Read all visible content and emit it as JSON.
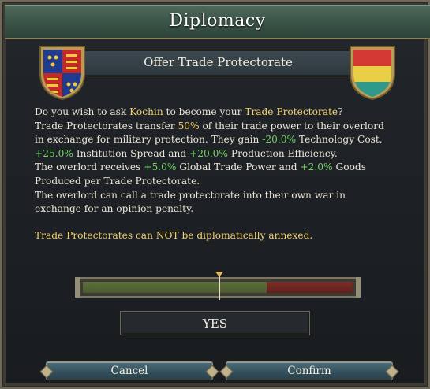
{
  "window": {
    "title": "Diplomacy"
  },
  "action": {
    "title": "Offer Trade Protectorate"
  },
  "body": {
    "q_prefix": "Do you wish to ask ",
    "q_country": "Kochin",
    "q_mid": " to become your ",
    "q_subject": "Trade Protectorate",
    "q_end": "?",
    "l2_a": "Trade Protectorates transfer ",
    "l2_pct": "50%",
    "l2_b": " of their trade power to their overlord in exchange for military protection. They gain ",
    "l2_tech": "-20.0%",
    "l2_c": " Technology Cost, ",
    "l2_inst": "+25.0%",
    "l2_d": " Institution Spread and ",
    "l2_prod": "+20.0%",
    "l2_e": " Production Efficiency.",
    "l3_a": "The overlord receives ",
    "l3_gtp": "+5.0%",
    "l3_b": " Global Trade Power and ",
    "l3_goods": "+2.0%",
    "l3_c": " Goods Produced per Trade Protectorate.",
    "l4": "The overlord can call a trade protectorate into their own war in exchange for an opinion penalty.",
    "warning": "Trade Protectorates can NOT be diplomatically annexed."
  },
  "acceptance": {
    "green_fraction": 0.68,
    "colors": {
      "positive": "#5d6f3d",
      "negative": "#7a2f28"
    }
  },
  "result": {
    "label": "YES"
  },
  "buttons": {
    "cancel": "Cancel",
    "confirm": "Confirm"
  },
  "icons": {
    "left_shield": "player-coat-of-arms-icon",
    "right_shield": "kochin-flag-icon",
    "marker": "acceptance-marker-icon"
  }
}
